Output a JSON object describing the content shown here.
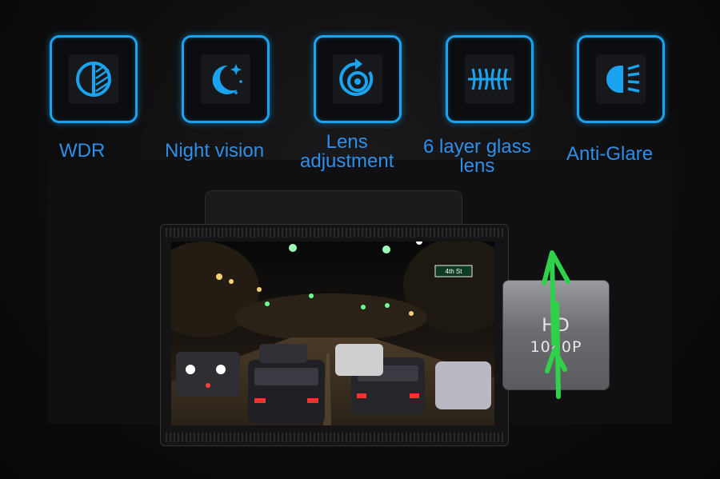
{
  "features": [
    {
      "icon": "wdr-icon",
      "label": "WDR"
    },
    {
      "icon": "night-vision-icon",
      "label": "Night vision"
    },
    {
      "icon": "lens-adjustment-icon",
      "label_lines": [
        "Lens",
        "adjustment"
      ]
    },
    {
      "icon": "glass-lens-icon",
      "label_lines": [
        "6 layer glass",
        "lens"
      ]
    },
    {
      "icon": "anti-glare-icon",
      "label": "Anti-Glare"
    }
  ],
  "screen": {
    "street_sign": "4th St"
  },
  "hdmi": {
    "line1": "HD",
    "line2": "1080P"
  },
  "colors": {
    "accent": "#1aa3ef",
    "label": "#2f8fe8",
    "arrow": "#2fd14a"
  }
}
